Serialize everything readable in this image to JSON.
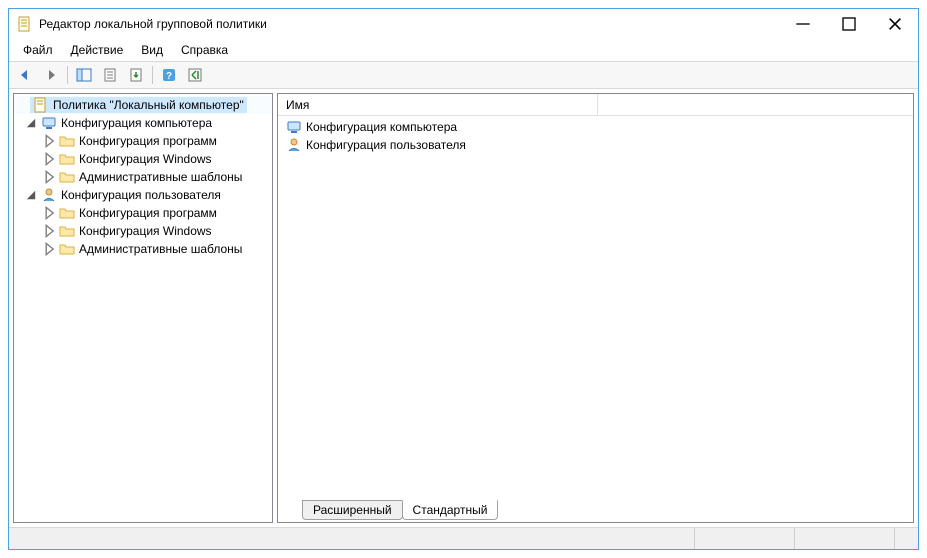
{
  "window": {
    "title": "Редактор локальной групповой политики"
  },
  "menubar": {
    "file": "Файл",
    "action": "Действие",
    "view": "Вид",
    "help": "Справка"
  },
  "tree": {
    "root": "Политика \"Локальный компьютер\"",
    "comp_config": "Конфигурация компьютера",
    "user_config": "Конфигурация пользователя",
    "soft_config": "Конфигурация программ",
    "win_config": "Конфигурация Windows",
    "admin_templates": "Административные шаблоны"
  },
  "list": {
    "header_name": "Имя",
    "row_comp": "Конфигурация компьютера",
    "row_user": "Конфигурация пользователя"
  },
  "tabs": {
    "extended": "Расширенный",
    "standard": "Стандартный"
  }
}
